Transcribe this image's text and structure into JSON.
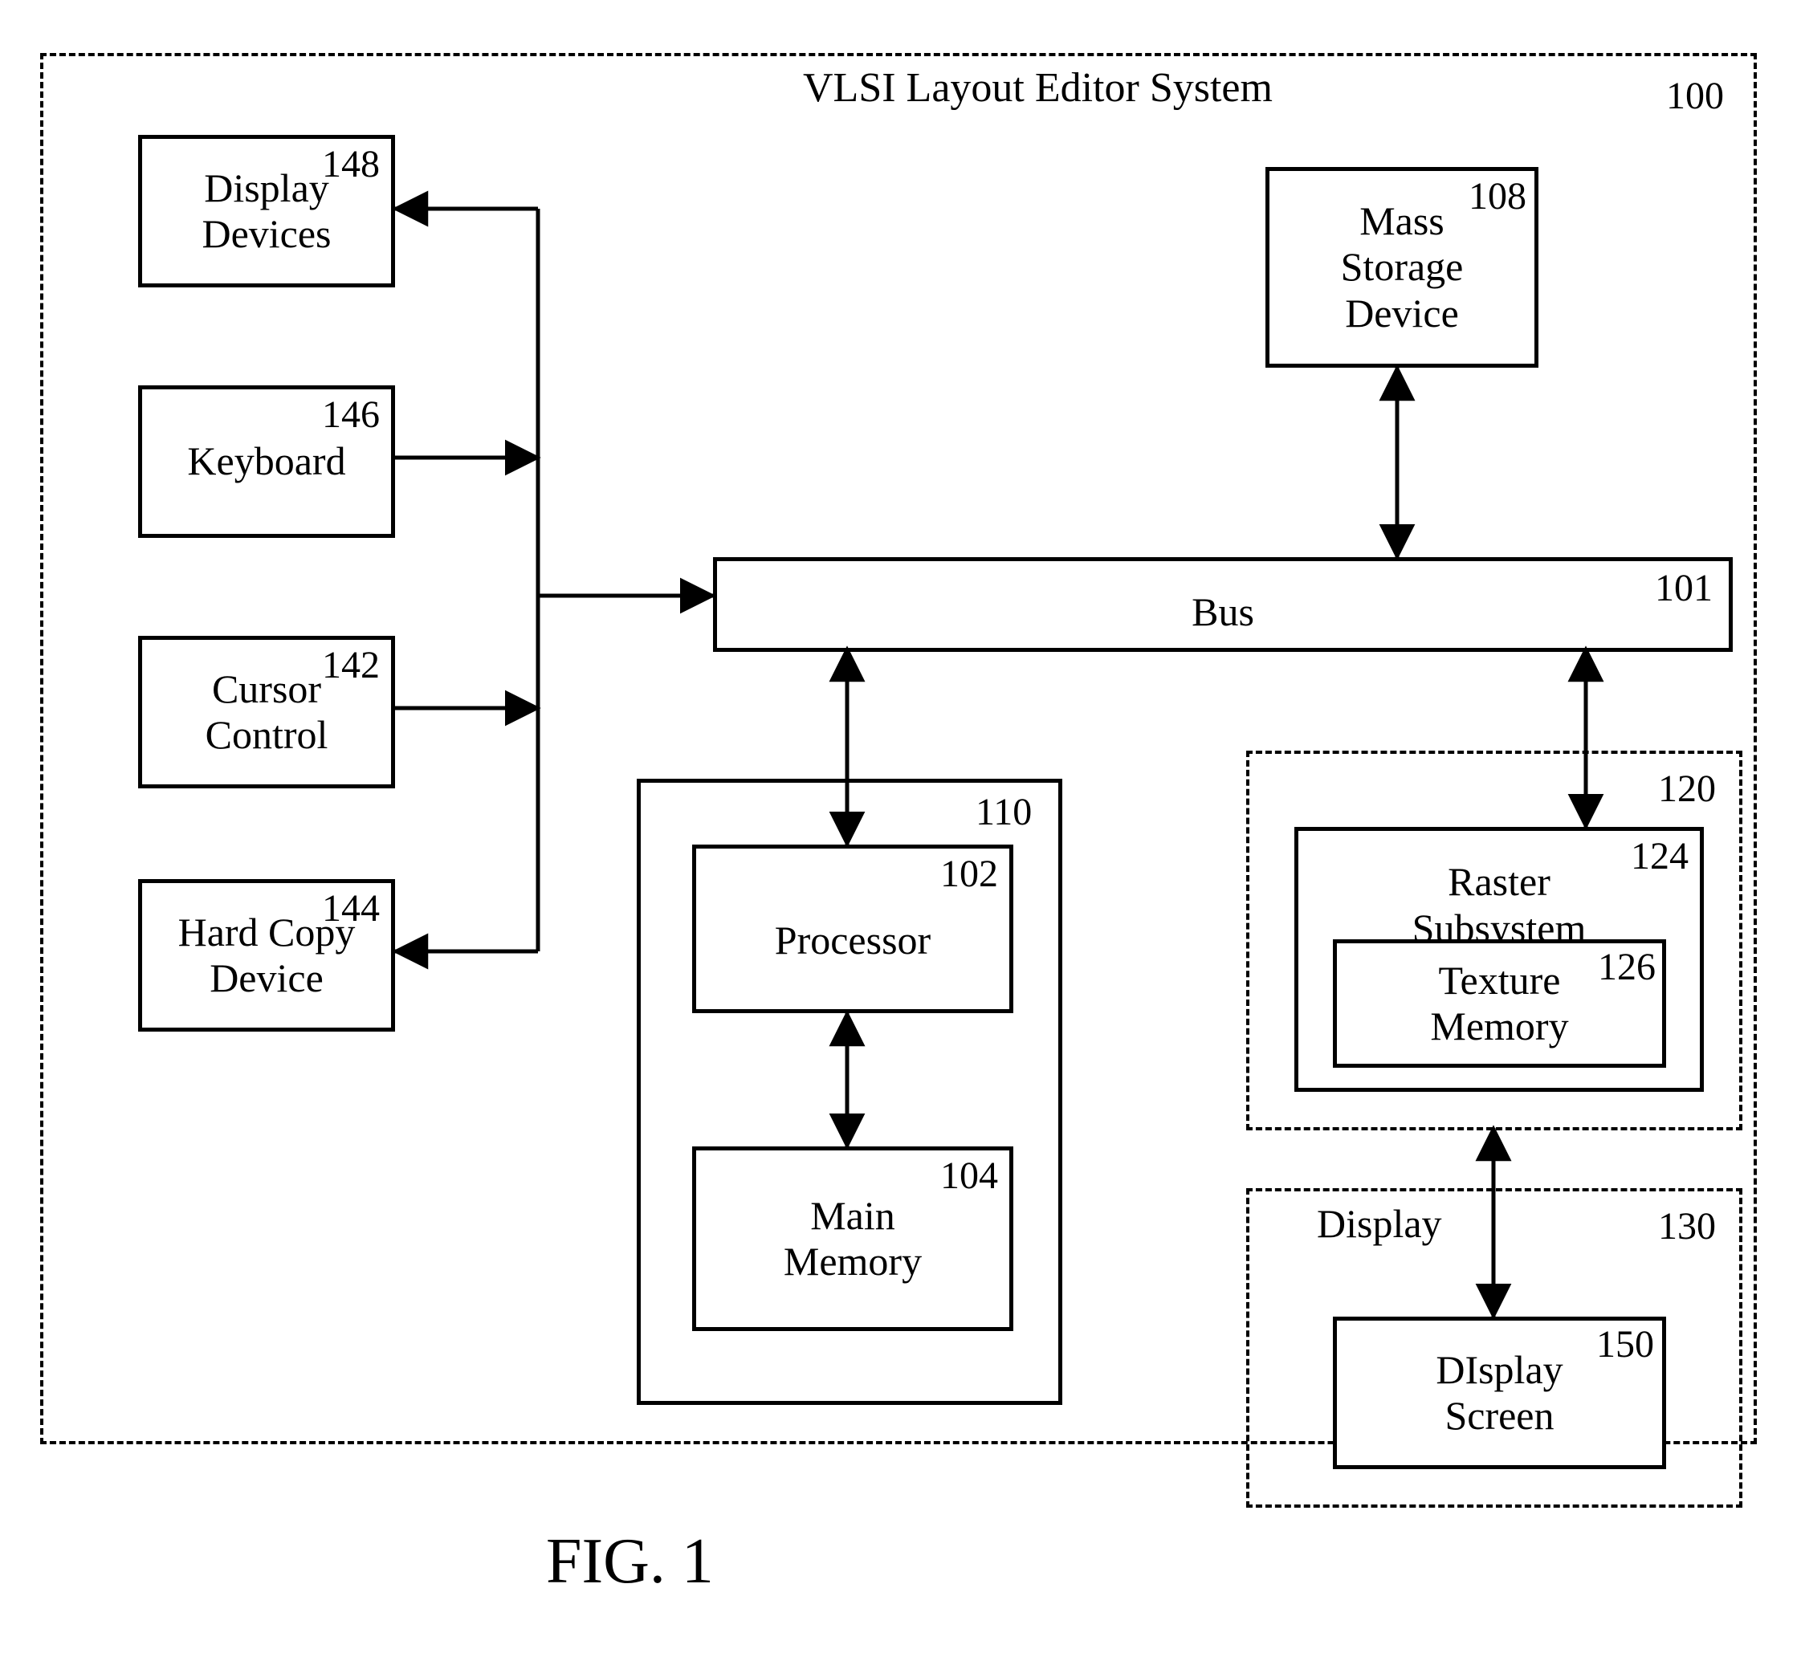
{
  "figure_caption": "FIG. 1",
  "system": {
    "title": "VLSI Layout Editor System",
    "ref": "100"
  },
  "bus": {
    "label": "Bus",
    "ref": "101"
  },
  "peripherals": {
    "display_devices": {
      "label_line1": "Display",
      "label_line2": "Devices",
      "ref": "148"
    },
    "keyboard": {
      "label": "Keyboard",
      "ref": "146"
    },
    "cursor_control": {
      "label_line1": "Cursor",
      "label_line2": "Control",
      "ref": "142"
    },
    "hard_copy": {
      "label_line1": "Hard Copy",
      "label_line2": "Device",
      "ref": "144"
    }
  },
  "mass_storage": {
    "label_line1": "Mass",
    "label_line2": "Storage",
    "label_line3": "Device",
    "ref": "108"
  },
  "proc_subsystem": {
    "ref": "110"
  },
  "processor": {
    "label": "Processor",
    "ref": "102"
  },
  "main_memory": {
    "label_line1": "Main",
    "label_line2": "Memory",
    "ref": "104"
  },
  "raster_subsystem_box": {
    "ref": "120"
  },
  "raster": {
    "label_line1": "Raster",
    "label_line2": "Subsystem",
    "ref": "124"
  },
  "texture": {
    "label_line1": "Texture",
    "label_line2": "Memory",
    "ref": "126"
  },
  "display_box": {
    "label": "Display",
    "ref": "130"
  },
  "display_screen": {
    "label_line1": "DIsplay",
    "label_line2": "Screen",
    "ref": "150"
  }
}
